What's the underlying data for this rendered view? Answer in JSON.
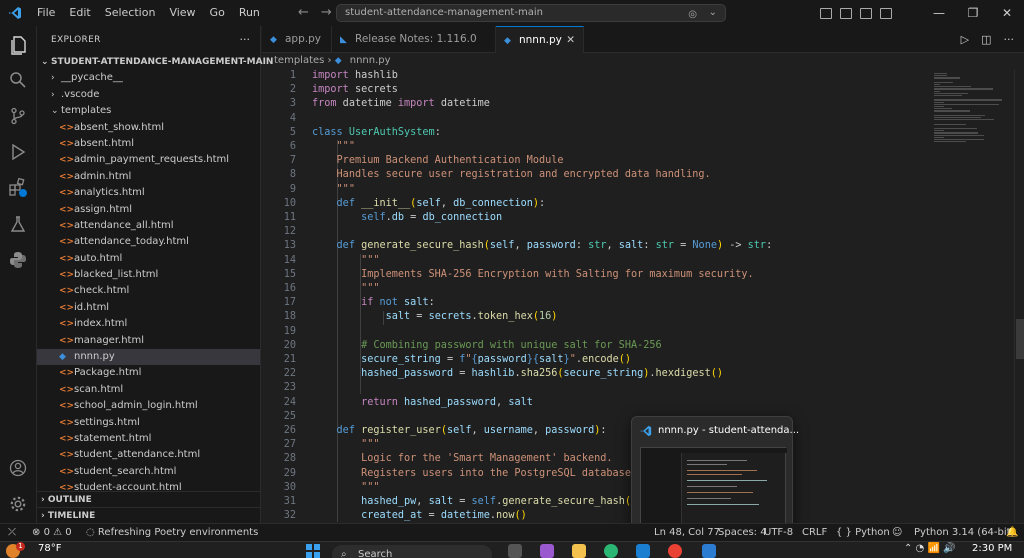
{
  "menu": [
    "File",
    "Edit",
    "Selection",
    "View",
    "Go",
    "Run"
  ],
  "command_center": {
    "text": "student-attendance-management-main"
  },
  "explorer": {
    "title": "EXPLORER",
    "root": "STUDENT-ATTENDANCE-MANAGEMENT-MAIN",
    "items": [
      {
        "label": "__pycache__",
        "type": "folder",
        "depth": 1
      },
      {
        "label": ".vscode",
        "type": "folder",
        "depth": 1
      },
      {
        "label": "templates",
        "type": "folder-open",
        "depth": 1
      },
      {
        "label": "absent_show.html",
        "type": "html",
        "depth": 2
      },
      {
        "label": "absent.html",
        "type": "html",
        "depth": 2
      },
      {
        "label": "admin_payment_requests.html",
        "type": "html",
        "depth": 2
      },
      {
        "label": "admin.html",
        "type": "html",
        "depth": 2
      },
      {
        "label": "analytics.html",
        "type": "html",
        "depth": 2
      },
      {
        "label": "assign.html",
        "type": "html",
        "depth": 2
      },
      {
        "label": "attendance_all.html",
        "type": "html",
        "depth": 2
      },
      {
        "label": "attendance_today.html",
        "type": "html",
        "depth": 2
      },
      {
        "label": "auto.html",
        "type": "html",
        "depth": 2
      },
      {
        "label": "blacked_list.html",
        "type": "html",
        "depth": 2
      },
      {
        "label": "check.html",
        "type": "html",
        "depth": 2
      },
      {
        "label": "id.html",
        "type": "html",
        "depth": 2
      },
      {
        "label": "index.html",
        "type": "html",
        "depth": 2
      },
      {
        "label": "manager.html",
        "type": "html",
        "depth": 2
      },
      {
        "label": "nnnn.py",
        "type": "py",
        "depth": 2,
        "selected": true
      },
      {
        "label": "Package.html",
        "type": "html",
        "depth": 2
      },
      {
        "label": "scan.html",
        "type": "html",
        "depth": 2
      },
      {
        "label": "school_admin_login.html",
        "type": "html",
        "depth": 2
      },
      {
        "label": "settings.html",
        "type": "html",
        "depth": 2
      },
      {
        "label": "statement.html",
        "type": "html",
        "depth": 2
      },
      {
        "label": "student_attendance.html",
        "type": "html",
        "depth": 2
      },
      {
        "label": "student_search.html",
        "type": "html",
        "depth": 2
      },
      {
        "label": "student-account.html",
        "type": "html",
        "depth": 2
      }
    ],
    "outline": "OUTLINE",
    "timeline": "TIMELINE"
  },
  "tabs": [
    {
      "label": "app.py",
      "icon": "python-icon"
    },
    {
      "label": "Release Notes: 1.116.0",
      "icon": "vscode-icon"
    },
    {
      "label": "nnnn.py",
      "icon": "python-icon",
      "active": true
    }
  ],
  "breadcrumb": {
    "folder": "templates",
    "file": "nnnn.py"
  },
  "code_lines": [
    [
      [
        "kw",
        "import"
      ],
      [
        "code",
        " hashlib"
      ]
    ],
    [
      [
        "kw",
        "import"
      ],
      [
        "code",
        " secrets"
      ]
    ],
    [
      [
        "kw",
        "from"
      ],
      [
        "code",
        " datetime "
      ],
      [
        "kw",
        "import"
      ],
      [
        "code",
        " datetime"
      ]
    ],
    [],
    [
      [
        "kw2",
        "class"
      ],
      [
        "code",
        " "
      ],
      [
        "cls",
        "UserAuthSystem"
      ],
      [
        "code",
        ":"
      ]
    ],
    [
      [
        "code",
        "    "
      ],
      [
        "doc",
        "\"\"\""
      ]
    ],
    [
      [
        "code",
        "    "
      ],
      [
        "doc",
        "Premium Backend Authentication Module"
      ]
    ],
    [
      [
        "code",
        "    "
      ],
      [
        "doc",
        "Handles secure user registration and encrypted data handling."
      ]
    ],
    [
      [
        "code",
        "    "
      ],
      [
        "doc",
        "\"\"\""
      ]
    ],
    [
      [
        "code",
        "    "
      ],
      [
        "kw2",
        "def"
      ],
      [
        "code",
        " "
      ],
      [
        "fn",
        "__init__"
      ],
      [
        "br",
        "("
      ],
      [
        "var",
        "self"
      ],
      [
        "code",
        ", "
      ],
      [
        "var",
        "db_connection"
      ],
      [
        "br",
        ")"
      ],
      [
        "code",
        ":"
      ]
    ],
    [
      [
        "code",
        "        "
      ],
      [
        "kw2",
        "self"
      ],
      [
        "code",
        "."
      ],
      [
        "var",
        "db"
      ],
      [
        "code",
        " = "
      ],
      [
        "var",
        "db_connection"
      ]
    ],
    [],
    [
      [
        "code",
        "    "
      ],
      [
        "kw2",
        "def"
      ],
      [
        "code",
        " "
      ],
      [
        "fn",
        "generate_secure_hash"
      ],
      [
        "br",
        "("
      ],
      [
        "var",
        "self"
      ],
      [
        "code",
        ", "
      ],
      [
        "var",
        "password"
      ],
      [
        "code",
        ": "
      ],
      [
        "cls",
        "str"
      ],
      [
        "code",
        ", "
      ],
      [
        "var",
        "salt"
      ],
      [
        "code",
        ": "
      ],
      [
        "cls",
        "str"
      ],
      [
        "code",
        " = "
      ],
      [
        "kw2",
        "None"
      ],
      [
        "br",
        ")"
      ],
      [
        "code",
        " -> "
      ],
      [
        "cls",
        "str"
      ],
      [
        "code",
        ":"
      ]
    ],
    [
      [
        "code",
        "        "
      ],
      [
        "doc",
        "\"\"\""
      ]
    ],
    [
      [
        "code",
        "        "
      ],
      [
        "doc",
        "Implements SHA-256 Encryption with Salting for maximum security."
      ]
    ],
    [
      [
        "code",
        "        "
      ],
      [
        "doc",
        "\"\"\""
      ]
    ],
    [
      [
        "code",
        "        "
      ],
      [
        "kw",
        "if"
      ],
      [
        "code",
        " "
      ],
      [
        "kw2",
        "not"
      ],
      [
        "code",
        " "
      ],
      [
        "var",
        "salt"
      ],
      [
        "code",
        ":"
      ]
    ],
    [
      [
        "code",
        "            "
      ],
      [
        "var",
        "salt"
      ],
      [
        "code",
        " = "
      ],
      [
        "var",
        "secrets"
      ],
      [
        "code",
        "."
      ],
      [
        "fn",
        "token_hex"
      ],
      [
        "br",
        "("
      ],
      [
        "num",
        "16"
      ],
      [
        "br",
        ")"
      ]
    ],
    [],
    [
      [
        "code",
        "        "
      ],
      [
        "cm",
        "# Combining password with unique salt for SHA-256"
      ]
    ],
    [
      [
        "code",
        "        "
      ],
      [
        "var",
        "secure_string"
      ],
      [
        "code",
        " = "
      ],
      [
        "kw2",
        "f"
      ],
      [
        "str",
        "\""
      ],
      [
        "kw2",
        "{"
      ],
      [
        "var",
        "password"
      ],
      [
        "kw2",
        "}{"
      ],
      [
        "var",
        "salt"
      ],
      [
        "kw2",
        "}"
      ],
      [
        "str",
        "\""
      ],
      [
        "code",
        "."
      ],
      [
        "fn",
        "encode"
      ],
      [
        "br",
        "()"
      ]
    ],
    [
      [
        "code",
        "        "
      ],
      [
        "var",
        "hashed_password"
      ],
      [
        "code",
        " = "
      ],
      [
        "var",
        "hashlib"
      ],
      [
        "code",
        "."
      ],
      [
        "fn",
        "sha256"
      ],
      [
        "br",
        "("
      ],
      [
        "var",
        "secure_string"
      ],
      [
        "br",
        ")"
      ],
      [
        "code",
        "."
      ],
      [
        "fn",
        "hexdigest"
      ],
      [
        "br",
        "()"
      ]
    ],
    [],
    [
      [
        "code",
        "        "
      ],
      [
        "kw",
        "return"
      ],
      [
        "code",
        " "
      ],
      [
        "var",
        "hashed_password"
      ],
      [
        "code",
        ", "
      ],
      [
        "var",
        "salt"
      ]
    ],
    [],
    [
      [
        "code",
        "    "
      ],
      [
        "kw2",
        "def"
      ],
      [
        "code",
        " "
      ],
      [
        "fn",
        "register_user"
      ],
      [
        "br",
        "("
      ],
      [
        "var",
        "self"
      ],
      [
        "code",
        ", "
      ],
      [
        "var",
        "username"
      ],
      [
        "code",
        ", "
      ],
      [
        "var",
        "password"
      ],
      [
        "br",
        ")"
      ],
      [
        "code",
        ":"
      ]
    ],
    [
      [
        "code",
        "        "
      ],
      [
        "doc",
        "\"\"\""
      ]
    ],
    [
      [
        "code",
        "        "
      ],
      [
        "doc",
        "Logic for the 'Smart Management' backend."
      ]
    ],
    [
      [
        "code",
        "        "
      ],
      [
        "doc",
        "Registers users into the PostgreSQL database se"
      ]
    ],
    [
      [
        "code",
        "        "
      ],
      [
        "doc",
        "\"\"\""
      ]
    ],
    [
      [
        "code",
        "        "
      ],
      [
        "var",
        "hashed_pw"
      ],
      [
        "code",
        ", "
      ],
      [
        "var",
        "salt"
      ],
      [
        "code",
        " = "
      ],
      [
        "kw2",
        "self"
      ],
      [
        "code",
        "."
      ],
      [
        "fn",
        "generate_secure_hash"
      ],
      [
        "br",
        "("
      ],
      [
        "var",
        "pas"
      ]
    ],
    [
      [
        "code",
        "        "
      ],
      [
        "var",
        "created_at"
      ],
      [
        "code",
        " = "
      ],
      [
        "var",
        "datetime"
      ],
      [
        "code",
        "."
      ],
      [
        "fn",
        "now"
      ],
      [
        "br",
        "()"
      ]
    ]
  ],
  "preview": {
    "title": "nnnn.py - student-attenda..."
  },
  "status": {
    "errors": "0",
    "warnings": "0",
    "task": "Refreshing Poetry environments",
    "position": "Ln 48, Col 77",
    "spaces": "Spaces: 4",
    "encoding": "UTF-8",
    "eol": "CRLF",
    "language": "Python",
    "interpreter": "Python 3.14 (64-bit)"
  },
  "taskbar": {
    "weather": "78°F",
    "search": "Search",
    "clock": "2:30 PM",
    "notif_count": "1"
  },
  "colors": {
    "accent": "#0078d4",
    "bg": "#1f1f1f",
    "sidebar": "#181818"
  }
}
